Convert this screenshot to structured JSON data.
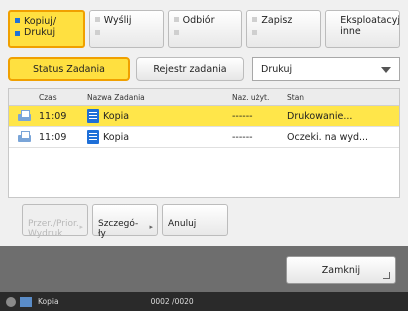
{
  "tabs": [
    {
      "label": "Kopiuj/\nDrukuj",
      "active": true
    },
    {
      "label": "Wyślij",
      "active": false
    },
    {
      "label": "Odbiór",
      "active": false
    },
    {
      "label": "Zapisz",
      "active": false
    },
    {
      "label": "Eksploatacyj./\ninne",
      "active": false
    }
  ],
  "subtabs": {
    "status_label": "Status Zadania",
    "log_label": "Rejestr zadania"
  },
  "dropdown": {
    "selected": "Drukuj"
  },
  "table": {
    "headers": {
      "time": "Czas",
      "name": "Nazwa Zadania",
      "pages": "Naz. użyt.",
      "status": "Stan"
    },
    "rows": [
      {
        "time": "11:09",
        "name": "Kopia",
        "pages": "------",
        "status": "Drukowanie...",
        "selected": true
      },
      {
        "time": "11:09",
        "name": "Kopia",
        "pages": "------",
        "status": "Oczeki. na wyd...",
        "selected": false
      }
    ]
  },
  "actions": {
    "prior_label": "Przer./Prior.\nWydruk",
    "details_label": "Szczegó-\nły",
    "cancel_label": "Anuluj"
  },
  "close_label": "Zamknij",
  "statusbar": {
    "job_label": "Kopia",
    "counter": "0002 /0020"
  }
}
